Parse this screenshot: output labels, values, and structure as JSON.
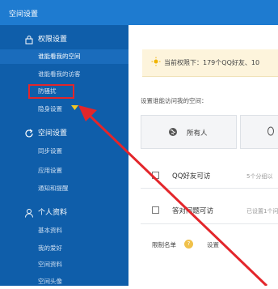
{
  "window": {
    "title": "空间设置"
  },
  "sidebar": {
    "sections": [
      {
        "label": "权限设置",
        "icon": "lock-icon",
        "items": [
          {
            "label": "谁能看我的空间",
            "active": true
          },
          {
            "label": "谁能看我的访客"
          },
          {
            "label": "防骚扰"
          },
          {
            "label": "隐身设置"
          }
        ]
      },
      {
        "label": "空间设置",
        "icon": "refresh-icon",
        "items": [
          {
            "label": "同步设置"
          },
          {
            "label": "应用设置"
          },
          {
            "label": "通知和提醒"
          }
        ]
      },
      {
        "label": "个人资料",
        "icon": "user-icon",
        "items": [
          {
            "label": "基本资料"
          },
          {
            "label": "我的爱好"
          },
          {
            "label": "空间资料"
          },
          {
            "label": "空间头像"
          }
        ]
      }
    ]
  },
  "main": {
    "notice": "当前权限下：179个QQ好友、10",
    "question": "设置谁能访问我的空间：",
    "options": [
      {
        "label": "所有人"
      }
    ],
    "rows": [
      {
        "label": "QQ好友可访",
        "note": "5个分组以"
      },
      {
        "label": "答对问题可访",
        "note": "已设置1个问题"
      }
    ],
    "blacklist": {
      "label": "限制名单",
      "help": "?",
      "action": "设置"
    }
  },
  "colors": {
    "header": "#1e7bd0",
    "sidebar": "#0f5eaa",
    "highlight": "#e3262b"
  }
}
